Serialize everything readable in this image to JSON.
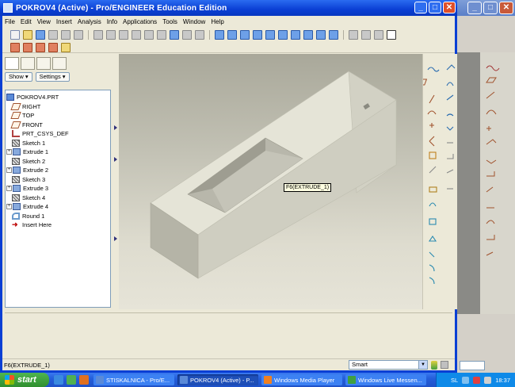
{
  "window": {
    "title": "POKROV4 (Active) - Pro/ENGINEER Education Edition",
    "minimize": "_",
    "maximize": "□",
    "close": "✕"
  },
  "background_window": {
    "minimize": "_",
    "maximize": "□",
    "close": "✕"
  },
  "menu": [
    "File",
    "Edit",
    "View",
    "Insert",
    "Analysis",
    "Info",
    "Applications",
    "Tools",
    "Window",
    "Help"
  ],
  "left_panel": {
    "show_label": "Show ▾",
    "settings_label": "Settings ▾",
    "tree": [
      {
        "label": "POKROV4.PRT",
        "icon": "part-icon",
        "expandable": false,
        "indent": 0
      },
      {
        "label": "RIGHT",
        "icon": "datum-plane-icon",
        "expandable": false,
        "indent": 1
      },
      {
        "label": "TOP",
        "icon": "datum-plane-icon",
        "expandable": false,
        "indent": 1
      },
      {
        "label": "FRONT",
        "icon": "datum-plane-icon",
        "expandable": false,
        "indent": 1
      },
      {
        "label": "PRT_CSYS_DEF",
        "icon": "csys-icon",
        "expandable": false,
        "indent": 1
      },
      {
        "label": "Sketch 1",
        "icon": "sketch-icon",
        "expandable": false,
        "indent": 1
      },
      {
        "label": "Extrude 1",
        "icon": "extrude-icon",
        "expandable": true,
        "indent": 0
      },
      {
        "label": "Sketch 2",
        "icon": "sketch-icon",
        "expandable": false,
        "indent": 1
      },
      {
        "label": "Extrude 2",
        "icon": "extrude-icon",
        "expandable": true,
        "indent": 0
      },
      {
        "label": "Sketch 3",
        "icon": "sketch-icon",
        "expandable": false,
        "indent": 1
      },
      {
        "label": "Extrude 3",
        "icon": "extrude-icon",
        "expandable": true,
        "indent": 0
      },
      {
        "label": "Sketch 4",
        "icon": "sketch-icon",
        "expandable": false,
        "indent": 1
      },
      {
        "label": "Extrude 4",
        "icon": "extrude-icon",
        "expandable": true,
        "indent": 0
      },
      {
        "label": "Round 1",
        "icon": "round-icon",
        "expandable": false,
        "indent": 1
      },
      {
        "label": "Insert Here",
        "icon": "insert-here-icon",
        "expandable": false,
        "indent": 1
      }
    ]
  },
  "viewport": {
    "tooltip": "F6(EXTRUDE_1)"
  },
  "status": {
    "message": "F6(EXTRUDE_1)",
    "filter_value": "Smart"
  },
  "taskbar": {
    "start_label": "start",
    "tasks": [
      {
        "label": "STISKALNICA - Pro/E...",
        "active": false,
        "icon_color": "#5a8ad8"
      },
      {
        "label": "POKROV4 (Active) - P...",
        "active": true,
        "icon_color": "#5a8ad8"
      },
      {
        "label": "Windows Media Player",
        "active": false,
        "icon_color": "#f08020"
      },
      {
        "label": "Windows Live Messen...",
        "active": false,
        "icon_color": "#40a040"
      }
    ],
    "tray_lang": "SL",
    "clock": "18:37"
  },
  "colors": {
    "titlebar": "#0a3fd4",
    "viewport_top": "#a9a89a",
    "viewport_bottom": "#e6e4d8",
    "part_face": "#e4e3d6",
    "part_side": "#c9c8bb"
  }
}
